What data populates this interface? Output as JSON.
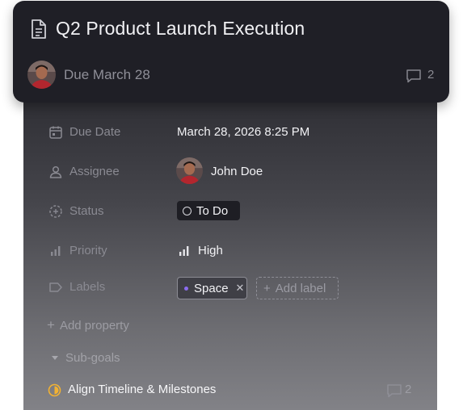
{
  "card": {
    "title": "Q2 Product Launch Execution",
    "due": "Due March 28",
    "comment_count": "2"
  },
  "properties": {
    "due_date": {
      "label": "Due Date",
      "value": "March 28, 2026 8:25 PM",
      "icon": "calendar-icon"
    },
    "assignee": {
      "label": "Assignee",
      "value": "John Doe",
      "icon": "person-icon"
    },
    "status": {
      "label": "Status",
      "value": "To Do",
      "icon": "status-dashed-circle-icon"
    },
    "priority": {
      "label": "Priority",
      "value": "High",
      "icon": "signal-bars-icon"
    },
    "labels": {
      "label": "Labels",
      "icon": "tag-icon",
      "items": [
        {
          "text": "Space",
          "color": "#8b6cf0"
        }
      ],
      "add_label": "Add label"
    }
  },
  "add_property": "Add property",
  "subgoals": {
    "heading": "Sub-goals",
    "items": [
      {
        "title": "Align Timeline & Milestones",
        "comment_count": "2",
        "status_color": "#f2b233"
      }
    ]
  },
  "colors": {
    "header_bg": "#1f1f26",
    "accent_label": "#8b6cf0",
    "in_progress": "#f2b233"
  }
}
